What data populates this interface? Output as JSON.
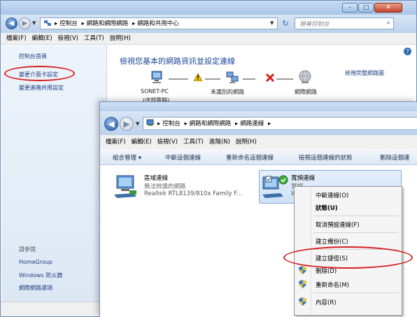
{
  "back_window": {
    "breadcrumb": [
      "控制台",
      "網路和網際網路",
      "網路和共用中心"
    ],
    "search_placeholder": "搜尋控制台",
    "menu": [
      "檔案(F)",
      "編輯(E)",
      "檢視(V)",
      "工具(T)",
      "說明(H)"
    ],
    "left_pane": {
      "home": "控制台首頁",
      "links": [
        "變更介面卡設定",
        "變更進階共用設定"
      ],
      "see_also_title": "請參閱",
      "see_also": [
        "HomeGroup",
        "Windows 防火牆",
        "網際網路選項"
      ]
    },
    "main": {
      "heading": "檢視您基本的網路資訊並設定連線",
      "full_map": "檢視完整網路圖",
      "nodes": [
        "SONET-PC",
        "未識別的網路",
        "網際網路"
      ],
      "node_sub": "(這部電腦)"
    }
  },
  "front_window": {
    "breadcrumb": [
      "控制台",
      "網路和網際網路",
      "網路連線"
    ],
    "menu": [
      "檔案(F)",
      "編輯(E)",
      "檢視(V)",
      "工具(T)",
      "進階(N)",
      "說明(H)"
    ],
    "commands": [
      "組合管理 ▾",
      "中斷這個連線",
      "重新命名這個連線",
      "檢視這個連線的狀態",
      "刪除這個連"
    ],
    "connections": [
      {
        "name": "區域連線",
        "status": "無法辨識的網路",
        "adapter": "Realtek RTL8139/810x Family F..."
      },
      {
        "name": "寬頻連線",
        "status": "寬頻",
        "adapter": "W"
      }
    ],
    "context_menu": [
      {
        "label": "中斷連線(O)",
        "bold": false
      },
      {
        "label": "狀態(U)",
        "bold": true
      },
      {
        "label": "取消預設連線(F)",
        "bold": false
      },
      {
        "label": "建立備份(C)",
        "bold": false
      },
      {
        "label": "建立捷徑(S)",
        "bold": false
      },
      {
        "label": "刪除(D)",
        "bold": false
      },
      {
        "label": "重新命名(M)",
        "bold": false
      },
      {
        "label": "內容(R)",
        "bold": false
      }
    ]
  },
  "colors": {
    "highlight_oval": "#d62020",
    "link": "#1d3c7d",
    "heading": "#1e4a96"
  }
}
